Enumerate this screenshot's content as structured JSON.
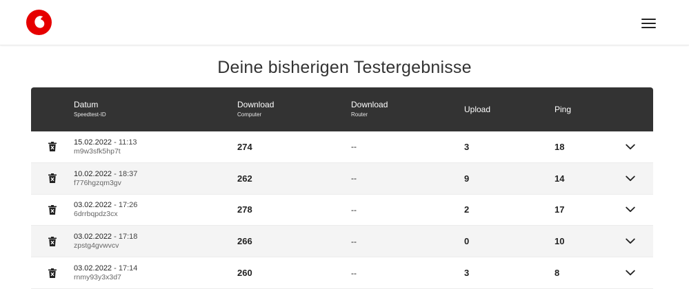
{
  "header": {
    "logo_icon": "vodafone-logo-icon",
    "menu_icon": "hamburger-menu-icon",
    "brand_color": "#e60000"
  },
  "page": {
    "title": "Deine bisherigen Testergebnisse"
  },
  "table": {
    "columns": [
      {
        "main": "Datum",
        "sub": "Speedtest-ID"
      },
      {
        "main": "Download",
        "sub": "Computer"
      },
      {
        "main": "Download",
        "sub": "Router"
      },
      {
        "main": "Upload",
        "sub": ""
      },
      {
        "main": "Ping",
        "sub": ""
      }
    ],
    "header_bg": "#333333",
    "rows": [
      {
        "date": "15.02.2022",
        "sep": " - ",
        "time": "11:13",
        "id": "m9w3sfk5hp7t",
        "download_computer": "274",
        "download_router": "--",
        "upload": "3",
        "ping": "18"
      },
      {
        "date": "10.02.2022",
        "sep": " - ",
        "time": "18:37",
        "id": "f776hgzqm3gv",
        "download_computer": "262",
        "download_router": "--",
        "upload": "9",
        "ping": "14"
      },
      {
        "date": "03.02.2022",
        "sep": " - ",
        "time": "17:26",
        "id": "6drrbqpdz3cx",
        "download_computer": "278",
        "download_router": "--",
        "upload": "2",
        "ping": "17"
      },
      {
        "date": "03.02.2022",
        "sep": " - ",
        "time": "17:18",
        "id": "zpstg4gvwvcv",
        "download_computer": "266",
        "download_router": "--",
        "upload": "0",
        "ping": "10"
      },
      {
        "date": "03.02.2022",
        "sep": " - ",
        "time": "17:14",
        "id": "rnmy93y3x3d7",
        "download_computer": "260",
        "download_router": "--",
        "upload": "3",
        "ping": "8"
      }
    ],
    "row_icons": {
      "delete": "trash-icon",
      "expand": "chevron-down-icon"
    }
  }
}
